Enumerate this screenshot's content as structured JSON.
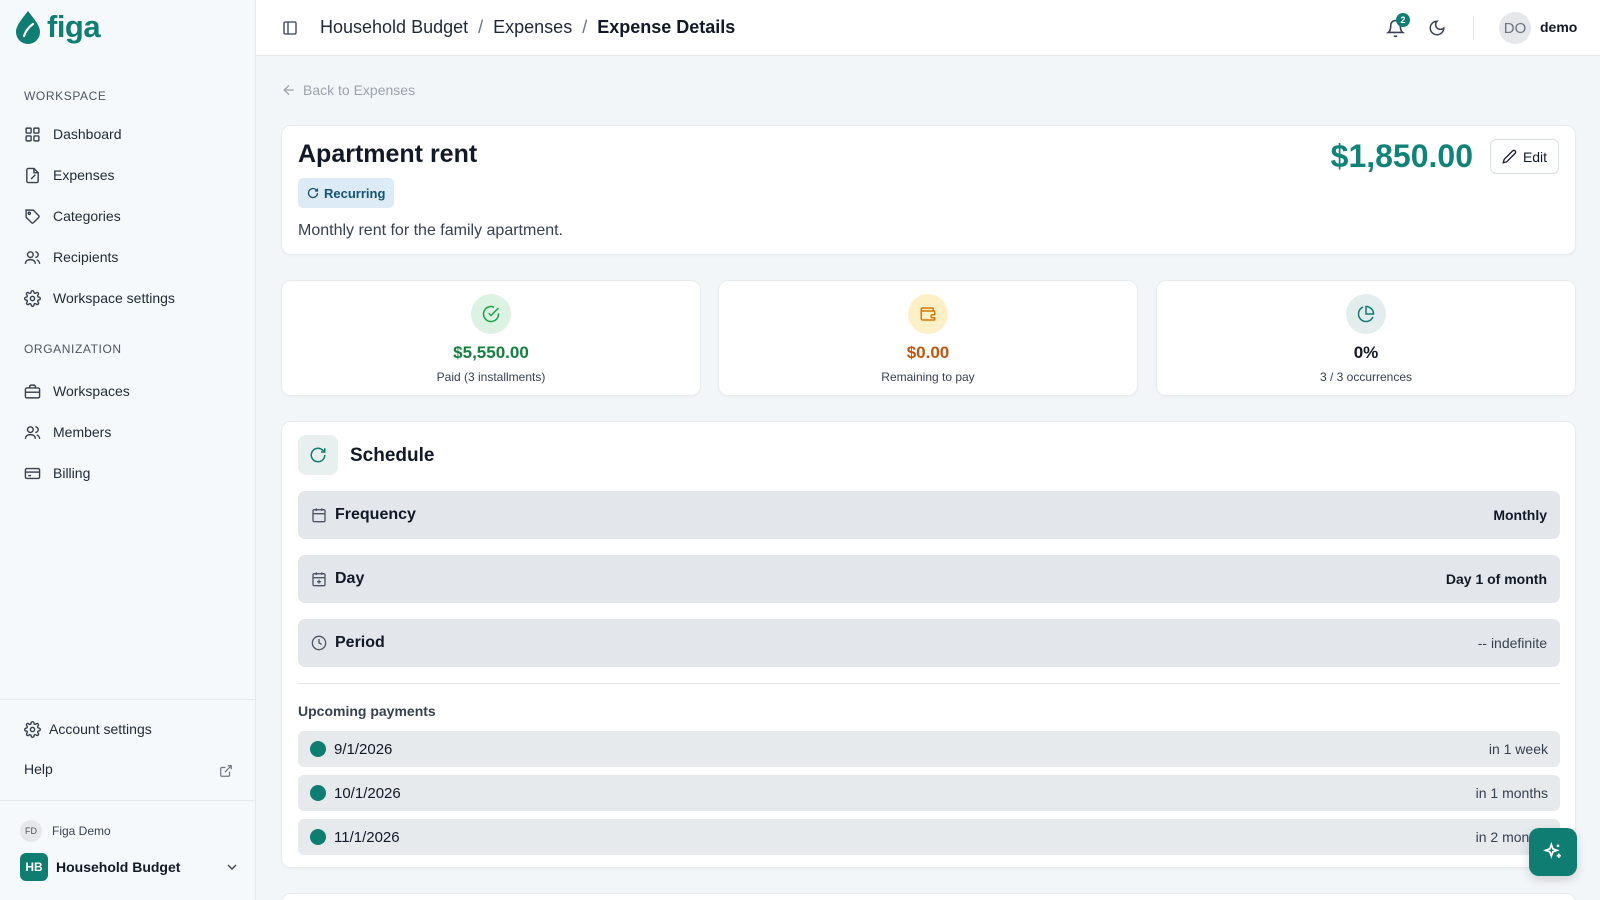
{
  "brand": {
    "name": "figa",
    "color": "#0f7d72"
  },
  "sidebar": {
    "workspace_heading": "WORKSPACE",
    "workspace_items": [
      {
        "label": "Dashboard",
        "icon": "grid-icon"
      },
      {
        "label": "Expenses",
        "icon": "receipt-icon"
      },
      {
        "label": "Categories",
        "icon": "tag-icon"
      },
      {
        "label": "Recipients",
        "icon": "users-icon"
      },
      {
        "label": "Workspace settings",
        "icon": "gear-icon"
      }
    ],
    "organization_heading": "ORGANIZATION",
    "organization_items": [
      {
        "label": "Workspaces",
        "icon": "briefcase-icon"
      },
      {
        "label": "Members",
        "icon": "users-icon"
      },
      {
        "label": "Billing",
        "icon": "credit-card-icon"
      }
    ],
    "account_settings": "Account settings",
    "help": "Help",
    "user": {
      "initials": "FD",
      "name": "Figa Demo"
    },
    "workspace": {
      "initials": "HB",
      "name": "Household Budget"
    }
  },
  "header": {
    "breadcrumb": [
      "Household Budget",
      "Expenses",
      "Expense Details"
    ],
    "separator": "/",
    "notification_count": "2",
    "user_initials": "DO",
    "user_name": "demo"
  },
  "main": {
    "back_label": "Back to Expenses",
    "expense": {
      "title": "Apartment rent",
      "badge": "Recurring",
      "description": "Monthly rent for the family apartment.",
      "amount": "$1,850.00",
      "edit_label": "Edit"
    },
    "stats": [
      {
        "value": "$5,550.00",
        "label": "Paid (3 installments)",
        "color": "#15803d",
        "icon": "check-circle-icon"
      },
      {
        "value": "$0.00",
        "label": "Remaining to pay",
        "color": "#c2570c",
        "icon": "wallet-icon"
      },
      {
        "value": "0%",
        "label": "3 / 3 occurrences",
        "color": "#111827",
        "icon": "pie-chart-icon"
      }
    ],
    "schedule": {
      "title": "Schedule",
      "rows": [
        {
          "label": "Frequency",
          "value": "Monthly"
        },
        {
          "label": "Day",
          "value": "Day 1 of month"
        },
        {
          "label": "Period",
          "value": "-- indefinite"
        }
      ],
      "upcoming_heading": "Upcoming payments",
      "upcoming": [
        {
          "date": "9/1/2026",
          "when": "in 1 week"
        },
        {
          "date": "10/1/2026",
          "when": "in 1 months"
        },
        {
          "date": "11/1/2026",
          "when": "in 2 months"
        }
      ]
    }
  }
}
